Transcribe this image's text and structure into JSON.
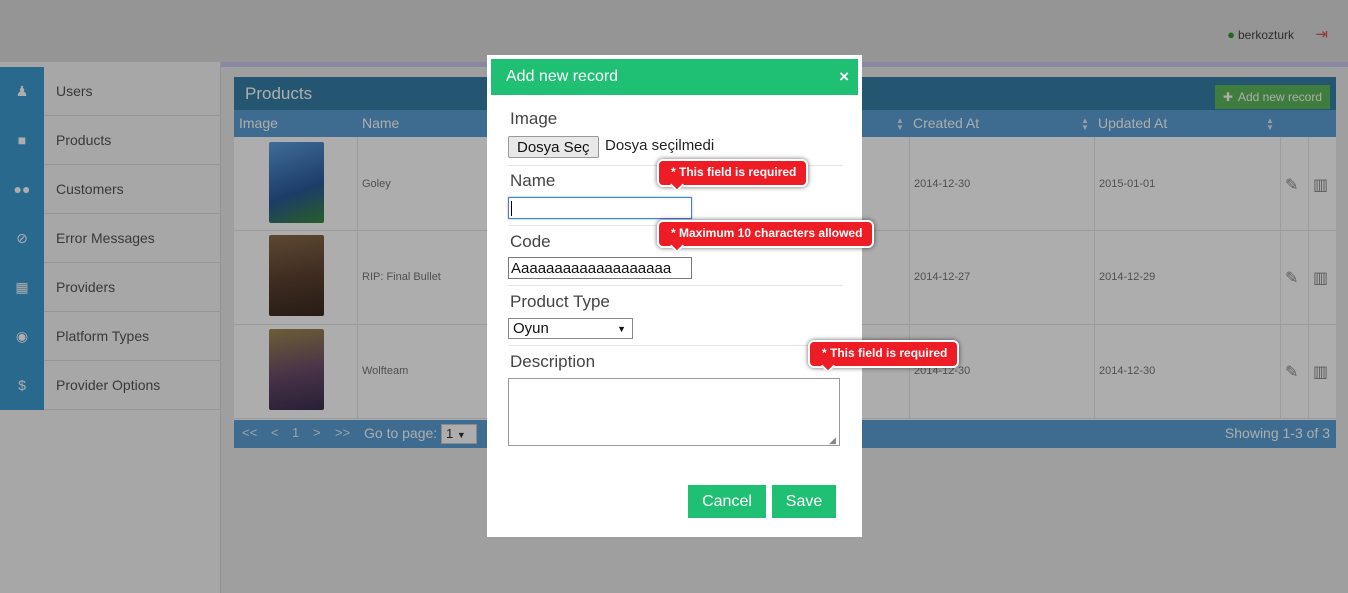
{
  "topbar": {
    "username": "berkozturk"
  },
  "sidebar": {
    "items": [
      {
        "label": "Users",
        "icon": "user-icon"
      },
      {
        "label": "Products",
        "icon": "briefcase-icon"
      },
      {
        "label": "Customers",
        "icon": "group-icon"
      },
      {
        "label": "Error Messages",
        "icon": "ban-icon"
      },
      {
        "label": "Providers",
        "icon": "columns-icon"
      },
      {
        "label": "Platform Types",
        "icon": "globe-icon"
      },
      {
        "label": "Provider Options",
        "icon": "dollar-icon"
      }
    ]
  },
  "panel": {
    "title": "Products",
    "add_label": "Add new record",
    "columns": [
      "Image",
      "Name",
      "Created At",
      "Updated At"
    ],
    "rows": [
      {
        "name": "Goley",
        "created": "2014-12-30",
        "updated": "2015-01-01",
        "thumb_color": "#3b6fb0"
      },
      {
        "name": "RIP: Final Bullet",
        "created": "2014-12-27",
        "updated": "2014-12-29",
        "thumb_color": "#7a5a3a"
      },
      {
        "name": "Wolfteam",
        "created": "2014-12-30",
        "updated": "2014-12-30",
        "thumb_color": "#5a4a6a"
      }
    ],
    "pager": {
      "first": "<<",
      "prev": "<",
      "page": "1",
      "next": ">",
      "last": ">>",
      "goto_label": "Go to page:",
      "goto_value": "1",
      "showing": "Showing 1-3 of 3"
    }
  },
  "modal": {
    "title": "Add new record",
    "close": "×",
    "fields": {
      "image_label": "Image",
      "file_button": "Dosya Seç",
      "file_status": "Dosya seçilmedi",
      "name_label": "Name",
      "name_value": "",
      "code_label": "Code",
      "code_value": "Aaaaaaaaaaaaaaaaaaa",
      "type_label": "Product Type",
      "type_value": "Oyun",
      "desc_label": "Description",
      "desc_value": ""
    },
    "cancel": "Cancel",
    "save": "Save",
    "errors": {
      "name": "* This field is required",
      "code": "* Maximum 10 characters allowed",
      "description": "* This field is required"
    }
  },
  "colors": {
    "accent": "#1fbf74",
    "error": "#ee1c24",
    "table_header": "#5a9fd4"
  }
}
